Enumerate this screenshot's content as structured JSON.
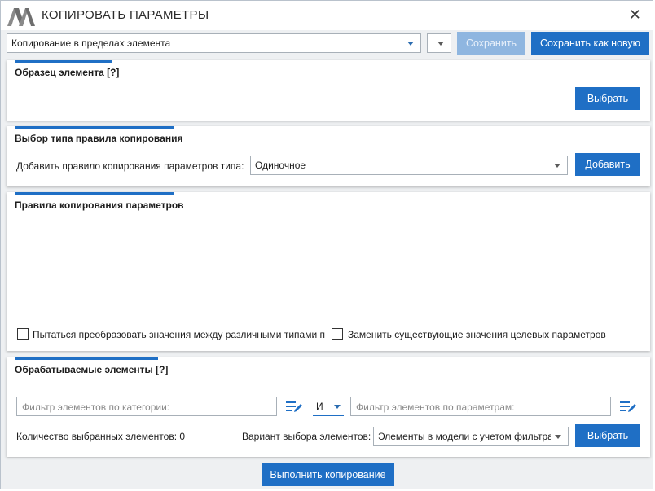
{
  "window": {
    "title": "КОПИРОВАТЬ ПАРАМЕТРЫ",
    "close_label": "✕"
  },
  "toolbar": {
    "preset_value": "Копирование в пределах элемента",
    "save_label": "Сохранить",
    "save_as_new_label": "Сохранить как новую"
  },
  "sample_panel": {
    "title": "Образец элемента [?]",
    "select_label": "Выбрать"
  },
  "rule_type_panel": {
    "title": "Выбор типа правила копирования",
    "add_rule_label": "Добавить правило копирования параметров типа:",
    "rule_type_value": "Одиночное",
    "add_label": "Добавить"
  },
  "rules_panel": {
    "title": "Правила копирования параметров",
    "convert_values_label": "Пытаться преобразовать значения между различными типами па",
    "replace_values_label": "Заменить существующие значения целевых параметров",
    "convert_values_checked": false,
    "replace_values_checked": false
  },
  "elements_panel": {
    "title": "Обрабатываемые элементы [?]",
    "category_filter_placeholder": "Фильтр элементов по категории:",
    "logic_operator": "И",
    "param_filter_placeholder": "Фильтр элементов по параметрам:",
    "selected_count_label": "Количество выбранных элементов: 0",
    "selection_mode_label": "Вариант выбора элементов:",
    "selection_mode_value": "Элементы в модели с учетом фильтра",
    "select_label": "Выбрать"
  },
  "footer": {
    "execute_label": "Выполнить копирование"
  },
  "icons": {
    "logo": "app-logo-icon",
    "filter_edit": "filter-edit-icon",
    "close": "close-icon",
    "dropdown": "chevron-down-icon"
  },
  "colors": {
    "accent": "#1f6fc5",
    "disabled_button": "#8fb6e0",
    "background": "#eef0f2"
  }
}
